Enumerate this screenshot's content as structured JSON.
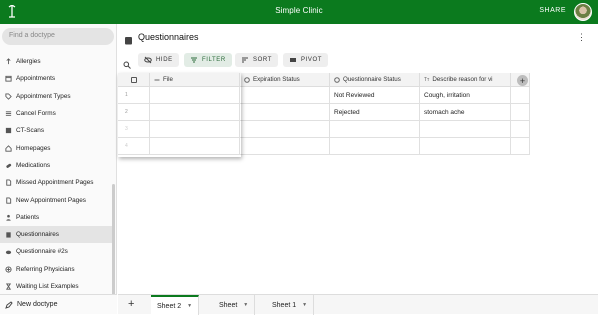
{
  "app": {
    "title": "Simple Clinic",
    "share_label": "SHARE"
  },
  "sidebar": {
    "search_placeholder": "Find a doctype",
    "items": [
      {
        "label": "Allergies",
        "icon": "allergy-icon"
      },
      {
        "label": "Appointments",
        "icon": "calendar-icon"
      },
      {
        "label": "Appointment Types",
        "icon": "tag-icon"
      },
      {
        "label": "Cancel Forms",
        "icon": "list-icon"
      },
      {
        "label": "CT-Scans",
        "icon": "scan-icon"
      },
      {
        "label": "Homepages",
        "icon": "home-icon"
      },
      {
        "label": "Medications",
        "icon": "pill-icon"
      },
      {
        "label": "Missed Appointment Pages",
        "icon": "page-icon"
      },
      {
        "label": "New Appointment Pages",
        "icon": "page-icon"
      },
      {
        "label": "Patients",
        "icon": "person-icon"
      },
      {
        "label": "Questionnaires",
        "icon": "clipboard-icon",
        "active": true
      },
      {
        "label": "Questionnaire #2s",
        "icon": "cloud-icon"
      },
      {
        "label": "Referring Physicians",
        "icon": "doctor-icon"
      },
      {
        "label": "Waiting List Examples",
        "icon": "hourglass-icon"
      }
    ],
    "new_doctype_label": "New doctype"
  },
  "page": {
    "title": "Questionnaires"
  },
  "toolbar": {
    "hide": "HIDE",
    "filter": "FILTER",
    "sort": "SORT",
    "pivot": "PIVOT"
  },
  "table": {
    "columns": [
      "File",
      "Expiration Status",
      "Questionnaire Status",
      "Describe reason for vi"
    ],
    "rows": [
      {
        "n": "1",
        "status": "Not Reviewed",
        "reason": "Cough, irritation"
      },
      {
        "n": "2",
        "status": "Rejected",
        "reason": "stomach ache"
      },
      {
        "n": "3",
        "status": "",
        "reason": ""
      },
      {
        "n": "4",
        "status": "",
        "reason": ""
      }
    ],
    "add_column_label": "+"
  },
  "sheets": [
    {
      "label": "Sheet 2",
      "active": true
    },
    {
      "label": "Sheet",
      "active": false
    },
    {
      "label": "Sheet 1",
      "active": false
    }
  ],
  "add_sheet_label": "+",
  "colors": {
    "brand": "#0b7a1e",
    "filter_active": "#2c6b3a"
  }
}
